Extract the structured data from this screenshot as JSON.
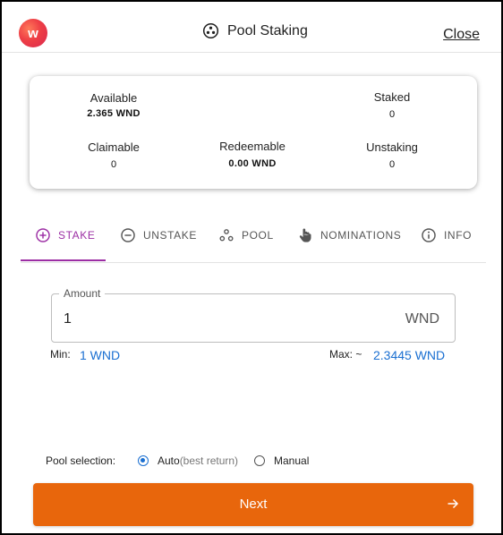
{
  "header": {
    "logo_letter": "w",
    "logo_icon": "app-logo-icon",
    "title_icon": "pool-icon",
    "title": "Pool Staking",
    "close_label": "Close"
  },
  "stats": {
    "available": {
      "label": "Available",
      "value": "2.365 WND"
    },
    "staked": {
      "label": "Staked",
      "value": "0"
    },
    "claimable": {
      "label": "Claimable",
      "value": "0"
    },
    "redeemable": {
      "label": "Redeemable",
      "value": "0.00 WND"
    },
    "unstaking": {
      "label": "Unstaking",
      "value": "0"
    }
  },
  "tabs": [
    {
      "label": "STAKE",
      "icon": "plus-circle-icon",
      "active": true
    },
    {
      "label": "UNSTAKE",
      "icon": "minus-circle-icon",
      "active": false
    },
    {
      "label": "POOL",
      "icon": "pool-icon",
      "active": false
    },
    {
      "label": "NOMINATIONS",
      "icon": "hand-pointer-icon",
      "active": false
    },
    {
      "label": "INFO",
      "icon": "info-icon",
      "active": false
    }
  ],
  "amount": {
    "legend": "Amount",
    "value": "1",
    "unit": "WND",
    "min_label": "Min:",
    "min_value": "1 WND",
    "max_label": "Max: ~",
    "max_value": "2.3445 WND"
  },
  "pool_selection": {
    "label": "Pool selection:",
    "options": [
      {
        "label": "Auto",
        "hint": "(best return)",
        "checked": true
      },
      {
        "label": "Manual",
        "hint": "",
        "checked": false
      }
    ]
  },
  "next_button": {
    "label": "Next",
    "icon": "arrow-right-icon"
  },
  "colors": {
    "accent": "#9c2ea4",
    "link": "#1a6fd1",
    "primary_button": "#e8660c"
  }
}
